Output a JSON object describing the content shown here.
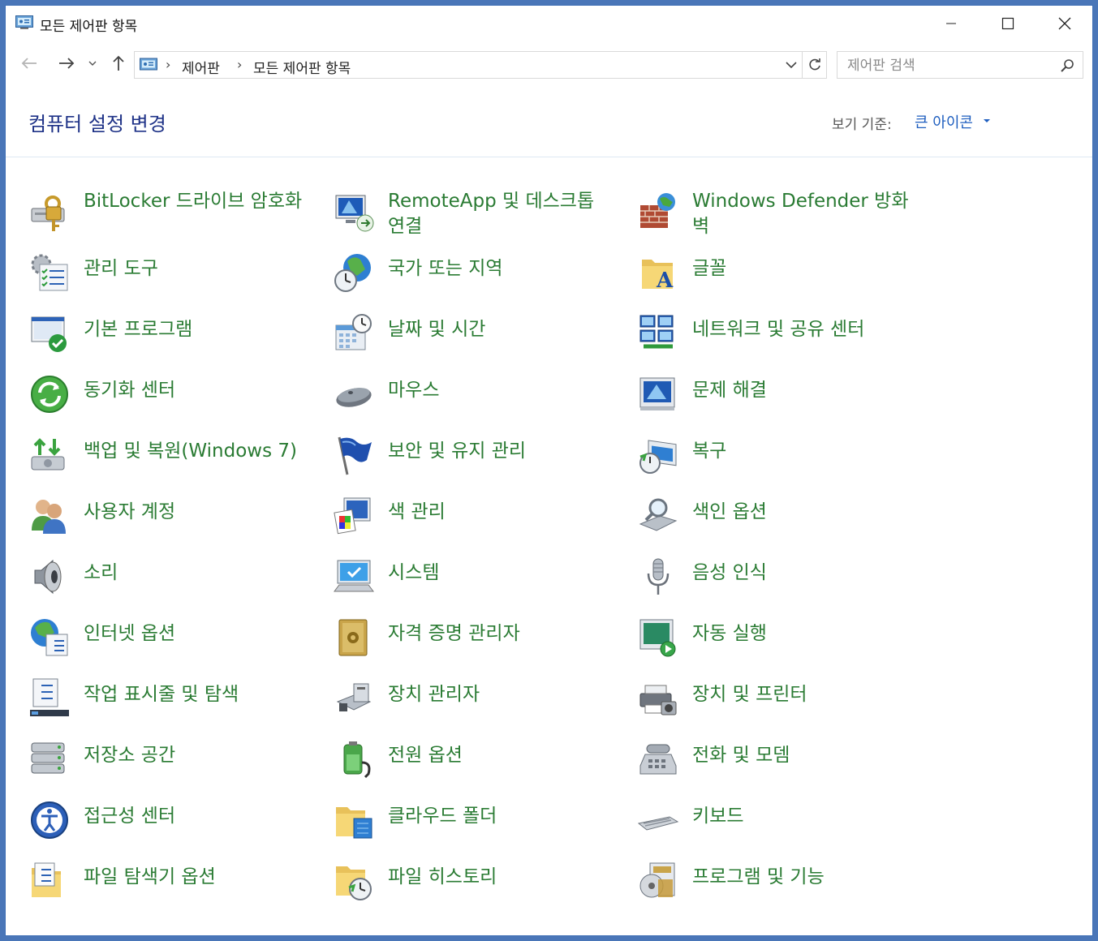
{
  "window": {
    "title": "모든 제어판 항목",
    "app_icon": "control-panel-icon",
    "buttons": [
      "minimize-icon",
      "maximize-icon",
      "close-icon"
    ]
  },
  "navigation": {
    "back_icon": "arrow-left-icon",
    "forward_icon": "arrow-right-icon",
    "recent_icon": "chevron-down-icon",
    "up_icon": "arrow-up-icon",
    "breadcrumb": [
      "제어판",
      "모든 제어판 항목"
    ],
    "search_placeholder": "제어판 검색"
  },
  "header": {
    "title": "컴퓨터 설정 변경",
    "view_by_label": "보기 기준:",
    "view_by_value": "큰 아이콘"
  },
  "items": [
    {
      "label": "BitLocker 드라이브 암호화",
      "icon": "bitlocker-icon"
    },
    {
      "label": "RemoteApp 및 데스크톱 연결",
      "icon": "remoteapp-icon"
    },
    {
      "label": "Windows Defender 방화벽",
      "icon": "firewall-icon"
    },
    {
      "label": "관리 도구",
      "icon": "admin-tools-icon"
    },
    {
      "label": "국가 또는 지역",
      "icon": "region-icon"
    },
    {
      "label": "글꼴",
      "icon": "fonts-icon"
    },
    {
      "label": "기본 프로그램",
      "icon": "default-programs-icon"
    },
    {
      "label": "날짜 및 시간",
      "icon": "date-time-icon"
    },
    {
      "label": "네트워크 및 공유 센터",
      "icon": "network-icon"
    },
    {
      "label": "동기화 센터",
      "icon": "sync-center-icon"
    },
    {
      "label": "마우스",
      "icon": "mouse-icon"
    },
    {
      "label": "문제 해결",
      "icon": "troubleshooting-icon"
    },
    {
      "label": "백업 및 복원(Windows 7)",
      "icon": "backup-icon"
    },
    {
      "label": "보안 및 유지 관리",
      "icon": "security-flag-icon"
    },
    {
      "label": "복구",
      "icon": "recovery-icon"
    },
    {
      "label": "사용자 계정",
      "icon": "user-accounts-icon"
    },
    {
      "label": "색 관리",
      "icon": "color-management-icon"
    },
    {
      "label": "색인 옵션",
      "icon": "indexing-icon"
    },
    {
      "label": "소리",
      "icon": "sound-icon"
    },
    {
      "label": "시스템",
      "icon": "system-icon"
    },
    {
      "label": "음성 인식",
      "icon": "microphone-icon"
    },
    {
      "label": "인터넷 옵션",
      "icon": "internet-options-icon"
    },
    {
      "label": "자격 증명 관리자",
      "icon": "credential-manager-icon"
    },
    {
      "label": "자동 실행",
      "icon": "autoplay-icon"
    },
    {
      "label": "작업 표시줄 및 탐색",
      "icon": "taskbar-icon"
    },
    {
      "label": "장치 관리자",
      "icon": "device-manager-icon"
    },
    {
      "label": "장치 및 프린터",
      "icon": "devices-printers-icon"
    },
    {
      "label": "저장소 공간",
      "icon": "storage-spaces-icon"
    },
    {
      "label": "전원 옵션",
      "icon": "power-options-icon"
    },
    {
      "label": "전화 및 모뎀",
      "icon": "phone-modem-icon"
    },
    {
      "label": "접근성 센터",
      "icon": "ease-of-access-icon"
    },
    {
      "label": "클라우드 폴더",
      "icon": "cloud-folder-icon"
    },
    {
      "label": "키보드",
      "icon": "keyboard-icon"
    },
    {
      "label": "파일 탐색기 옵션",
      "icon": "folder-options-icon"
    },
    {
      "label": "파일 히스토리",
      "icon": "file-history-icon"
    },
    {
      "label": "프로그램 및 기능",
      "icon": "programs-features-icon"
    }
  ]
}
